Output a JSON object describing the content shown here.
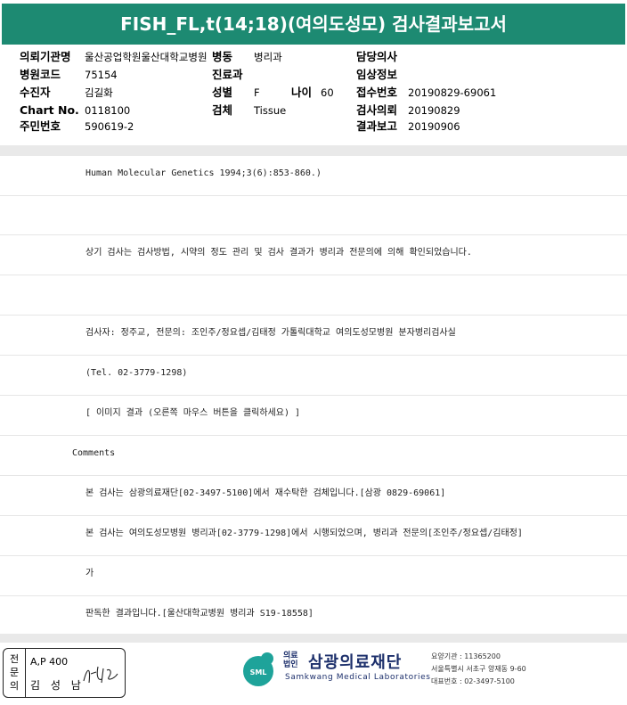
{
  "title": "FISH_FL,t(14;18)(여의도성모) 검사결과보고서",
  "header": {
    "institution_label": "의뢰기관명",
    "institution_value": "울산공업학원울산대학교병원",
    "ward_label": "병동",
    "ward_value": "병리과",
    "doctor_label": "담당의사",
    "doctor_value": "",
    "hospital_code_label": "병원코드",
    "hospital_code_value": "75154",
    "department_label": "진료과",
    "department_value": "",
    "clinical_info_label": "임상정보",
    "clinical_info_value": "",
    "patient_label": "수진자",
    "patient_value": "김길화",
    "sex_label": "성별",
    "sex_value": "F",
    "age_label": "나이",
    "age_value": "60",
    "receipt_label": "접수번호",
    "receipt_value": "20190829-69061",
    "chart_label": "Chart No.",
    "chart_value": "0118100",
    "specimen_label": "검체",
    "specimen_value": "Tissue",
    "request_label": "검사의뢰",
    "request_value": "20190829",
    "resident_label": "주민번호",
    "resident_value": "590619-2",
    "report_label": "결과보고",
    "report_value": "20190906"
  },
  "content_rows": [
    "Human Molecular Genetics 1994;3(6):853-860.)",
    "",
    "상기 검사는 검사방법, 시약의 정도 관리 및 검사 결과가 병리과 전문의에 의해 확인되었습니다.",
    "",
    "검사자: 정주교, 전문의: 조인주/정요셉/김태정 가톨릭대학교 여의도성모병원 분자병리검사실",
    "(Tel. 02-3779-1298)",
    "[ 이미지 결과 (오른쪽 마우스 버튼을 클릭하세요) ]",
    "Comments",
    "본 검사는 삼광의료재단[02-3497-5100]에서 재수탁한 검체입니다.[삼광 0829-69061]",
    "본 검사는 여의도성모병원 병리과[02-3779-1298]에서 시행되었으며, 병리과 전문의[조인주/정요셉/김태정]",
    "가",
    "판독한 결과입니다.[울산대학교병원 병리과 S19-18558]"
  ],
  "footer": {
    "stamp_chars": [
      "전",
      "문",
      "의"
    ],
    "stamp_line1": "A,P 400",
    "stamp_line2": "김 성 남",
    "logo_sub": "의료법인",
    "logo_name": "삼광의료재단",
    "logo_eng": "Samkwang Medical Laboratories",
    "logo_badge": "SML",
    "info_1": "요양기관 : 11365200",
    "info_2": "서울특별시 서초구 양재동 9-60",
    "info_3": "대표번호 : 02-3497-5100"
  },
  "colors": {
    "title_bg": "#1d8a72",
    "logo": "#1c2f6b",
    "logo_badge": "#1ea39a"
  }
}
